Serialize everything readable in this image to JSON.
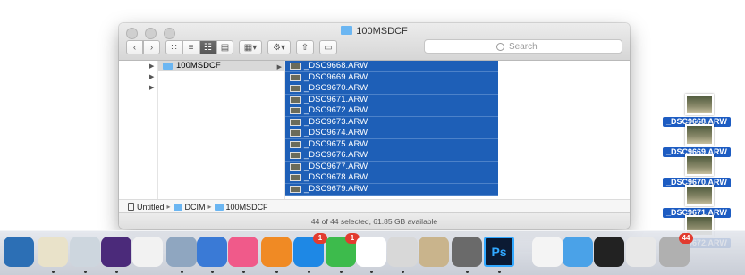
{
  "window": {
    "title": "100MSDCF",
    "search_placeholder": "Search",
    "status": "44 of 44 selected, 61.85 GB available"
  },
  "columns": {
    "col2_selected": "100MSDCF",
    "files": [
      "_DSC9668.ARW",
      "_DSC9669.ARW",
      "_DSC9670.ARW",
      "_DSC9671.ARW",
      "_DSC9672.ARW",
      "_DSC9673.ARW",
      "_DSC9674.ARW",
      "_DSC9675.ARW",
      "_DSC9676.ARW",
      "_DSC9677.ARW",
      "_DSC9678.ARW",
      "_DSC9679.ARW"
    ]
  },
  "pathbar": {
    "drive": "Untitled",
    "folder1": "DCIM",
    "folder2": "100MSDCF"
  },
  "desktop_items": [
    "_DSC9668.ARW",
    "_DSC9669.ARW",
    "_DSC9670.ARW",
    "_DSC9671.ARW",
    "_DSC9672.ARW"
  ],
  "dock": {
    "badges": {
      "app_store": "1",
      "facetime": "1",
      "trash": "44"
    },
    "photoshop_label": "Ps",
    "icons": [
      "earth-icon",
      "stickies-icon",
      "preview-icon",
      "imovie-icon",
      "photos-icon",
      "iphoto-icon",
      "keynote-icon",
      "itunes-icon",
      "ibooks-icon",
      "app-store-icon",
      "facetime-icon",
      "mindnode-icon",
      "parallels-icon",
      "preview-stack-icon",
      "system-preferences-icon",
      "photoshop-icon",
      "document-icon",
      "folder-icon",
      "terminal-icon",
      "screenshot-icon",
      "trash-icon"
    ]
  },
  "colors": {
    "selection": "#1e5fb7",
    "folder": "#6bb6f2",
    "badge": "#e23b2f"
  }
}
